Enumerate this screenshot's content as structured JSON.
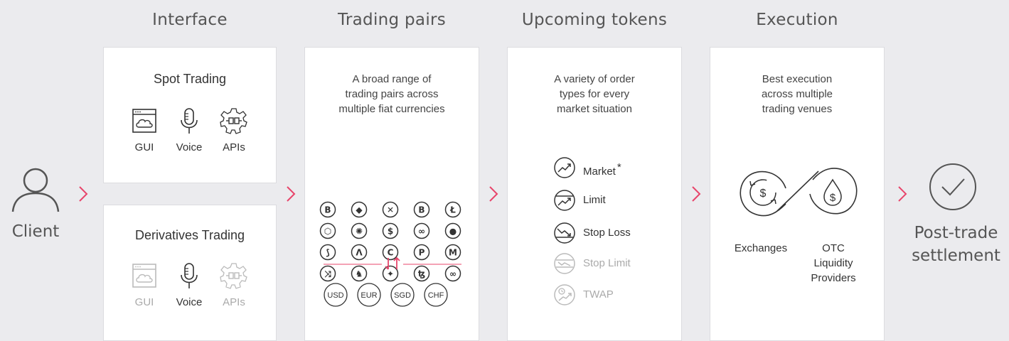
{
  "headings": {
    "interface": "Interface",
    "trading_pairs": "Trading pairs",
    "upcoming_tokens": "Upcoming tokens",
    "execution": "Execution"
  },
  "client": {
    "label": "Client"
  },
  "settlement": {
    "label": "Post-trade\nsettlement"
  },
  "spot": {
    "title": "Spot Trading",
    "channels": [
      {
        "label": "GUI",
        "icon": "browser-cloud-icon",
        "active": true
      },
      {
        "label": "Voice",
        "icon": "microphone-icon",
        "active": true
      },
      {
        "label": "APIs",
        "icon": "api-gear-icon",
        "active": true
      }
    ]
  },
  "derivatives": {
    "title": "Derivatives Trading",
    "channels": [
      {
        "label": "GUI",
        "icon": "browser-cloud-icon",
        "active": false
      },
      {
        "label": "Voice",
        "icon": "microphone-icon",
        "active": true
      },
      {
        "label": "APIs",
        "icon": "api-gear-icon",
        "active": false
      }
    ]
  },
  "pairs": {
    "description": "A broad range of\ntrading pairs across\nmultiple fiat currencies",
    "crypto_icons": [
      [
        "bitcoin-icon",
        "ethereum-icon",
        "xrp-icon",
        "bitcoin-cash-icon",
        "litecoin-icon"
      ],
      [
        "chainlink-icon",
        "cardano-icon",
        "usdc-icon",
        "polygon-icon",
        "uniswap-icon"
      ],
      [
        "stellar-icon",
        "aave-icon",
        "celo-icon",
        "pax-icon",
        "monero-icon"
      ],
      [
        "shuffle-icon",
        "unicorn-icon",
        "tezos-alt-icon",
        "tezos-icon",
        "infinity-icon"
      ]
    ],
    "fiat": [
      "USD",
      "EUR",
      "SGD",
      "CHF"
    ]
  },
  "orders": {
    "description": "A variety of order\ntypes for every\nmarket situation",
    "items": [
      {
        "label": "Market",
        "marker": "*",
        "icon": "market-order-icon",
        "active": true
      },
      {
        "label": "Limit",
        "marker": "",
        "icon": "limit-order-icon",
        "active": true
      },
      {
        "label": "Stop Loss",
        "marker": "",
        "icon": "stop-loss-icon",
        "active": true
      },
      {
        "label": "Stop Limit",
        "marker": "",
        "icon": "stop-limit-icon",
        "active": false
      },
      {
        "label": "TWAP",
        "marker": "",
        "icon": "twap-icon",
        "active": false
      }
    ]
  },
  "execution": {
    "description": "Best execution\nacross multiple\ntrading venues",
    "venues": [
      "Exchanges",
      "OTC\nLiquidity\nProviders"
    ]
  },
  "colors": {
    "accent": "#e8456b",
    "line": "#333333",
    "dim": "#bbbbbb"
  }
}
